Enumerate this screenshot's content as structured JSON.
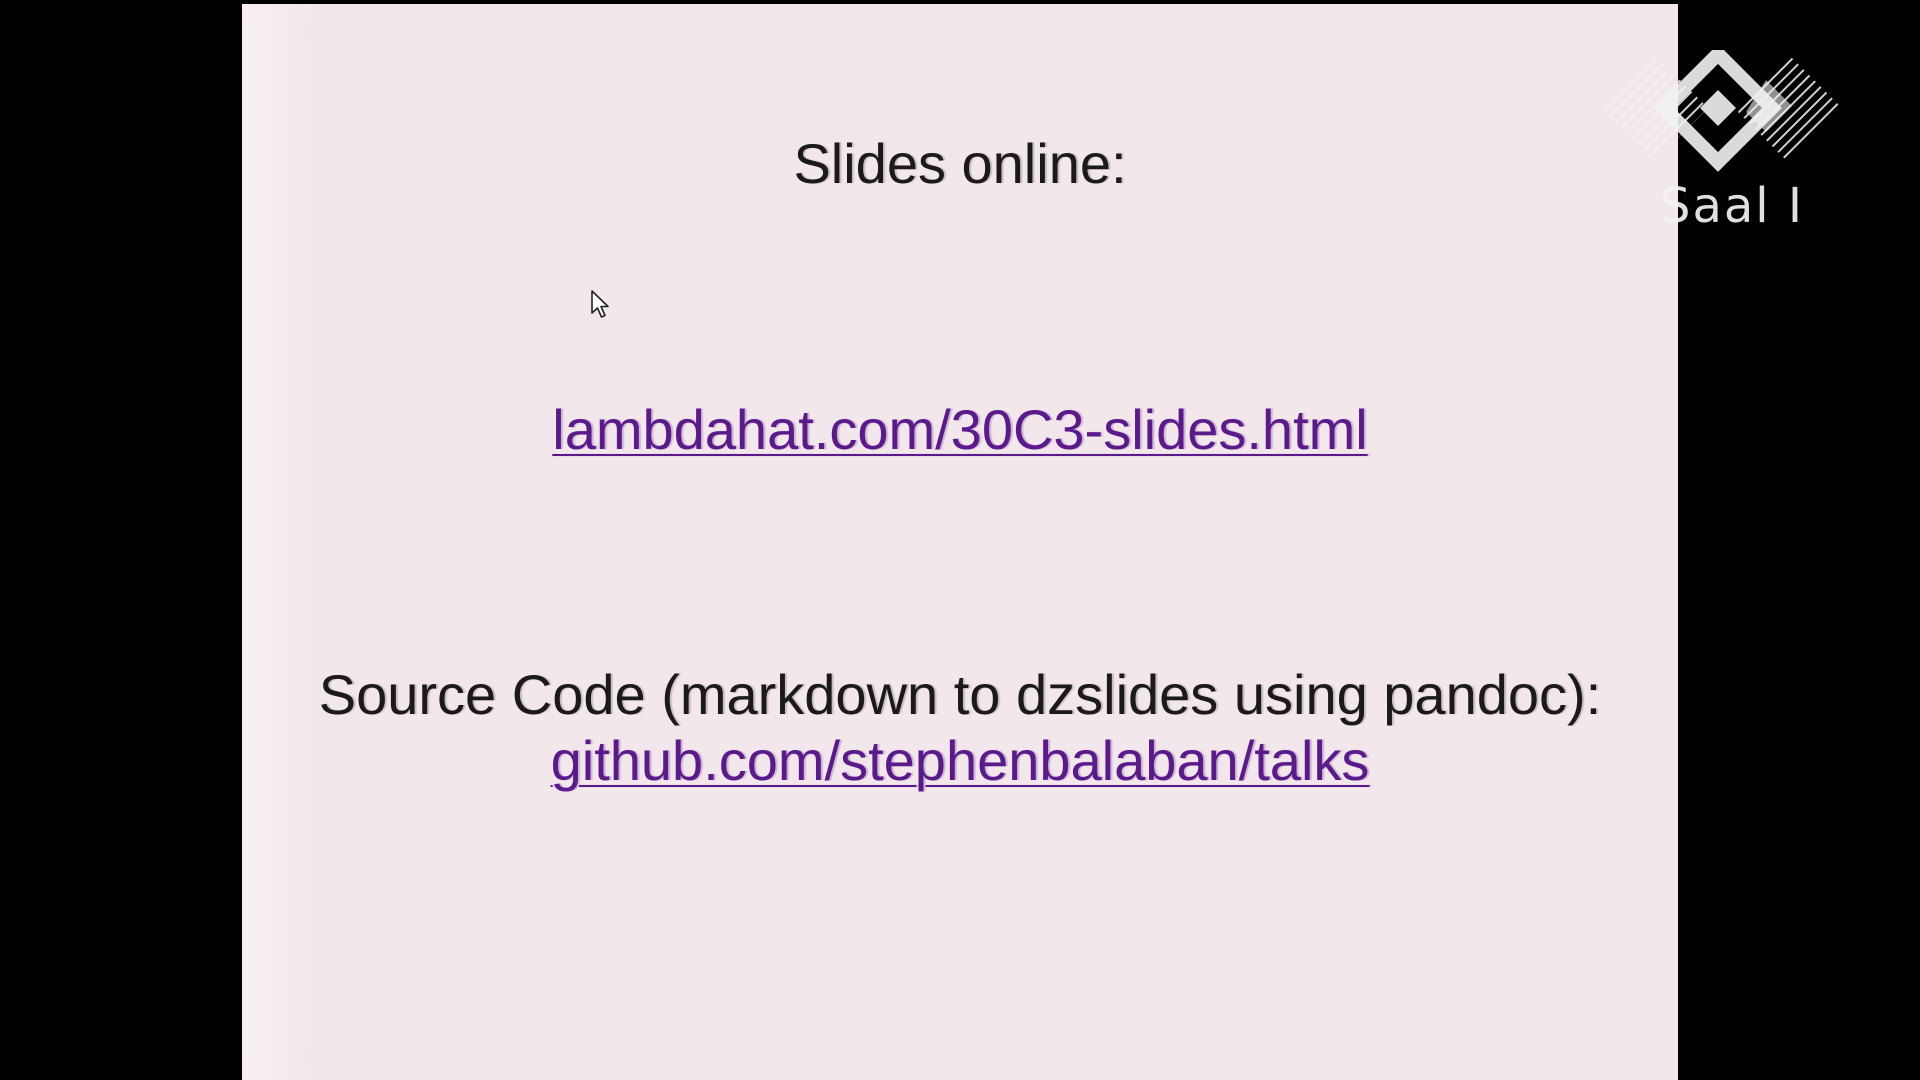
{
  "slide": {
    "heading": "Slides online:",
    "slides_link": "lambdahat.com/30C3-slides.html",
    "source_label": "Source Code (markdown to dzslides using pandoc):",
    "source_link": "github.com/stephenbalaban/talks"
  },
  "overlay": {
    "logo_icon": "30c3-logo-icon",
    "room_label": "Saal I"
  },
  "colors": {
    "background": "#000000",
    "slide_background": "#f2e7ea",
    "text": "#1a1a1a",
    "link": "#5b1a8c",
    "overlay": "#f4f4f4"
  }
}
